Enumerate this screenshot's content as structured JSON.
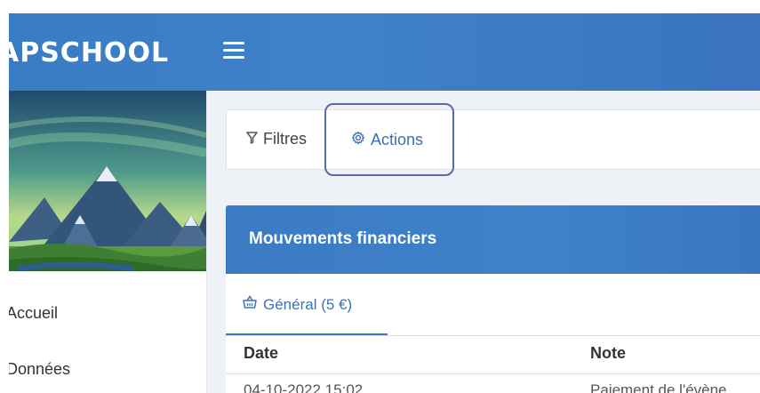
{
  "header": {
    "logo_text": "APSCHOOL",
    "menu_icon": "hamburger-icon"
  },
  "sidebar": {
    "items": [
      {
        "label": "Accueil"
      },
      {
        "label": "Données"
      }
    ]
  },
  "toolbar": {
    "filters_label": "Filtres",
    "filters_icon": "filter-icon",
    "actions_label": "Actions",
    "actions_icon": "gear-icon"
  },
  "card": {
    "title": "Mouvements financiers",
    "tabs": [
      {
        "label": "Général (5 €)",
        "icon": "basket-icon"
      }
    ],
    "columns": [
      "Date",
      "Note"
    ],
    "rows": [
      {
        "date": "04-10-2022 15:02",
        "note": "Paiement de l'évène"
      }
    ]
  },
  "colors": {
    "header_blue": "#3a7cc4",
    "accent_blue": "#3a73b8",
    "highlight_border": "#5b6aa8"
  }
}
